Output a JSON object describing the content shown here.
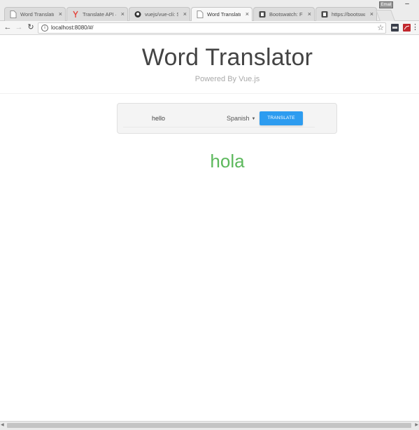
{
  "browser": {
    "tabs": [
      {
        "label": "Word Translator",
        "icon": "page-icon",
        "active": false
      },
      {
        "label": "Translate API — Y",
        "icon": "yandex-icon",
        "active": false
      },
      {
        "label": "vuejs/vue-cli: Sim",
        "icon": "github-icon",
        "active": false
      },
      {
        "label": "Word Translator",
        "icon": "page-icon",
        "active": true
      },
      {
        "label": "Bootswatch: Free",
        "icon": "bootswatch-icon",
        "active": false
      },
      {
        "label": "https://bootswatch",
        "icon": "bootswatch-icon",
        "active": false
      }
    ],
    "url": "localhost:8080/#/",
    "close_glyph": "×",
    "user_badge": "Email",
    "minimize_glyph": "–"
  },
  "app": {
    "title": "Word Translator",
    "subtitle": "Powered By Vue.js",
    "input_value": "hello",
    "language_selected": "Spanish",
    "translate_label": "TRANSLATE",
    "result": "hola"
  },
  "colors": {
    "accent_blue": "#2d9cf0",
    "result_green": "#5cb85c",
    "title_gray": "#444444"
  }
}
